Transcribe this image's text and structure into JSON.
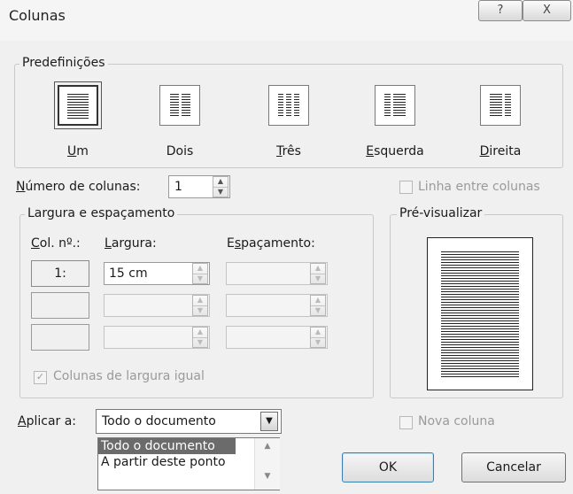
{
  "window": {
    "title": "Colunas",
    "help_label": "?",
    "close_label": "X"
  },
  "presets": {
    "group_label": "Predefinições",
    "items": [
      {
        "label": "Um",
        "accel": "U",
        "rest": "m",
        "selected": true
      },
      {
        "label": "Dois",
        "accel": "",
        "rest": "Dois",
        "selected": false
      },
      {
        "label": "Três",
        "accel": "T",
        "rest": "rês",
        "selected": false
      },
      {
        "label": "Esquerda",
        "accel": "E",
        "rest": "squerda",
        "selected": false
      },
      {
        "label": "Direita",
        "accel": "D",
        "rest": "ireita",
        "selected": false
      }
    ]
  },
  "num_columns": {
    "label_accel": "N",
    "label_rest": "úmero de colunas:",
    "value": "1"
  },
  "line_between": {
    "label": "Linha entre colunas",
    "checked": false
  },
  "width_spacing": {
    "group_label": "Largura e espaçamento",
    "col_header_accel": "C",
    "col_header_rest": "ol. nº.:",
    "width_header_accel": "L",
    "width_header_rest": "argura:",
    "spacing_header_pre": "E",
    "spacing_header_accel": "s",
    "spacing_header_rest": "paçamento:",
    "rows": [
      {
        "col": "1:",
        "width": "15 cm",
        "spacing": ""
      },
      {
        "col": "",
        "width": "",
        "spacing": ""
      },
      {
        "col": "",
        "width": "",
        "spacing": ""
      }
    ]
  },
  "equal_width": {
    "label": "Colunas de largura igual",
    "checked": true
  },
  "preview": {
    "group_label": "Pré-visualizar"
  },
  "apply_to": {
    "label_accel": "A",
    "label_rest": "plicar a:",
    "value": "Todo o documento",
    "options": [
      "Todo o documento",
      "A partir deste ponto"
    ]
  },
  "new_column": {
    "label": "Nova coluna",
    "checked": false
  },
  "buttons": {
    "ok": "OK",
    "cancel": "Cancelar"
  }
}
